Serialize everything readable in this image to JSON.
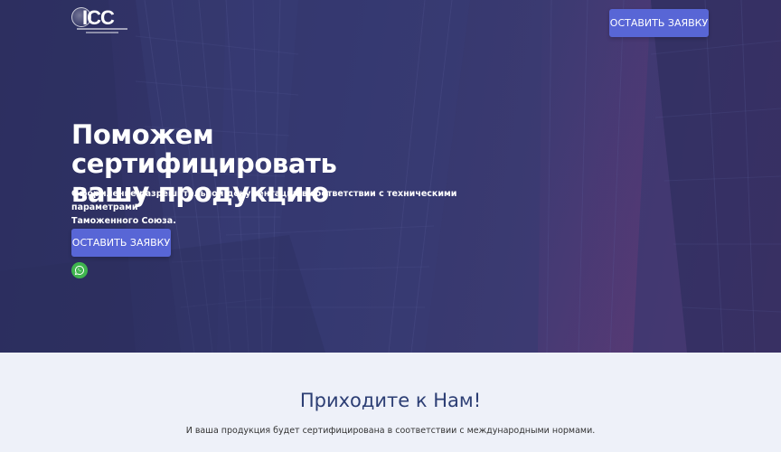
{
  "header": {
    "logo_text": "ICC",
    "cta_label": "ОСТАВИТЬ ЗАЯВКУ"
  },
  "hero": {
    "title_line1": "Поможем сертифицировать",
    "title_line2": "вашу продукцию",
    "subtitle_line1": "Оформление разрешительной документации в соответствии с техническими параметрами",
    "subtitle_line2": "Таможенного Союза.",
    "cta_label": "ОСТАВИТЬ ЗАЯВКУ",
    "whatsapp_icon": "whatsapp-icon"
  },
  "section2": {
    "title": "Приходите к Нам!",
    "text": "И ваша продукция будет сертифицирована в соответствии с международными нормами."
  },
  "colors": {
    "accent": "#5866d6",
    "hero_bg": "#33366b",
    "section_bg": "#eef1f9",
    "heading": "#2c3e74",
    "whatsapp": "#3fb54e"
  }
}
